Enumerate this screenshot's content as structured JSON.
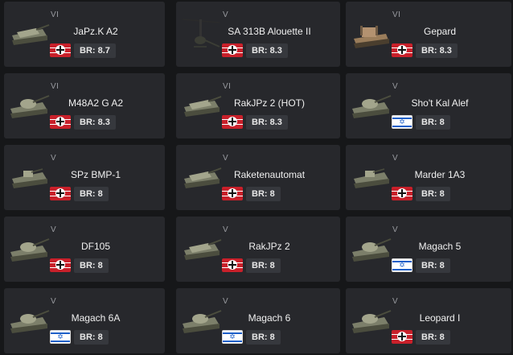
{
  "vehicles": [
    {
      "rank": "VI",
      "name": "JaPz.K A2",
      "br": "BR: 8.7",
      "nation": "germany",
      "icon": "tank-destroyer-icon"
    },
    {
      "rank": "V",
      "name": "SA 313B Alouette II",
      "br": "BR: 8.3",
      "nation": "germany",
      "icon": "helicopter-icon"
    },
    {
      "rank": "VI",
      "name": "Gepard",
      "br": "BR: 8.3",
      "nation": "germany",
      "icon": "spaa-icon"
    },
    {
      "rank": "VI",
      "name": "M48A2 G A2",
      "br": "BR: 8.3",
      "nation": "germany",
      "icon": "tank-icon"
    },
    {
      "rank": "VI",
      "name": "RakJPz 2 (HOT)",
      "br": "BR: 8.3",
      "nation": "germany",
      "icon": "tank-destroyer-icon"
    },
    {
      "rank": "V",
      "name": "Sho't Kal Alef",
      "br": "BR: 8",
      "nation": "israel",
      "icon": "tank-icon"
    },
    {
      "rank": "V",
      "name": "SPz BMP-1",
      "br": "BR: 8",
      "nation": "germany",
      "icon": "ifv-icon"
    },
    {
      "rank": "V",
      "name": "Raketenautomat",
      "br": "BR: 8",
      "nation": "germany",
      "icon": "rocket-vehicle-icon"
    },
    {
      "rank": "V",
      "name": "Marder 1A3",
      "br": "BR: 8",
      "nation": "germany",
      "icon": "ifv-icon"
    },
    {
      "rank": "V",
      "name": "DF105",
      "br": "BR: 8",
      "nation": "germany",
      "icon": "tank-icon"
    },
    {
      "rank": "V",
      "name": "RakJPz 2",
      "br": "BR: 8",
      "nation": "germany",
      "icon": "tank-destroyer-icon"
    },
    {
      "rank": "V",
      "name": "Magach 5",
      "br": "BR: 8",
      "nation": "israel",
      "icon": "tank-icon"
    },
    {
      "rank": "V",
      "name": "Magach 6A",
      "br": "BR: 8",
      "nation": "israel",
      "icon": "tank-icon"
    },
    {
      "rank": "V",
      "name": "Magach 6",
      "br": "BR: 8",
      "nation": "israel",
      "icon": "tank-icon"
    },
    {
      "rank": "V",
      "name": "Leopard I",
      "br": "BR: 8",
      "nation": "germany",
      "icon": "tank-icon"
    }
  ],
  "colors": {
    "background": "#161719",
    "card": "#27282c",
    "br_badge": "#36383d",
    "german_flag_red": "#c8202a",
    "israel_blue": "#1d5fc8"
  }
}
